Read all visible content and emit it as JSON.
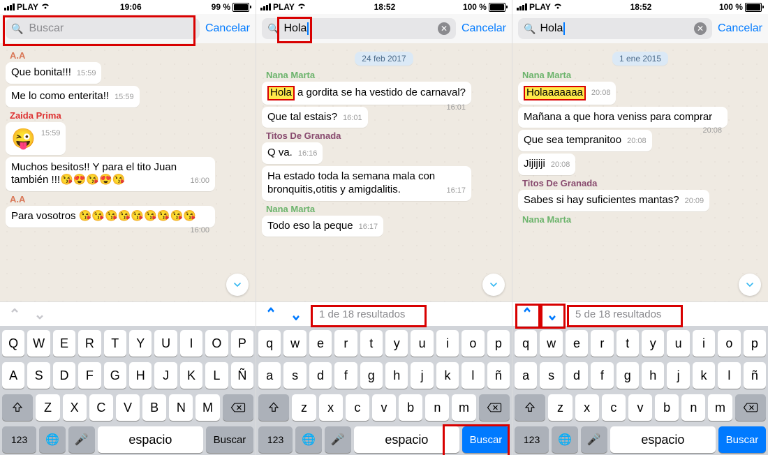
{
  "screens": [
    {
      "status": {
        "carrier": "PLAY",
        "time": "19:06",
        "battery": "99 %"
      },
      "search": {
        "placeholder": "Buscar",
        "value": "",
        "cancel": "Cancelar",
        "has_clear": false,
        "typed": false
      },
      "redboxes": {
        "search_field": true
      },
      "conversation": [
        {
          "type": "sender",
          "cls": "aa",
          "name": "A.A"
        },
        {
          "type": "msg",
          "text": "Que bonita!!!",
          "ts": "15:59"
        },
        {
          "type": "msg",
          "text": "Me lo como enterita!!",
          "ts": "15:59"
        },
        {
          "type": "sender",
          "cls": "zaida",
          "name": "Zaida Prima"
        },
        {
          "type": "msg",
          "html": "<span class='emoji'>😜</span>",
          "ts": "15:59"
        },
        {
          "type": "msg",
          "text": "Muchos besitos!! Y para el tito Juan también !!!😘😍😘😍😘",
          "ts": "16:00"
        },
        {
          "type": "sender",
          "cls": "aa",
          "name": "A.A"
        },
        {
          "type": "msg",
          "text": "Para vosotros 😘😘😘😘😘😘😘😘😘",
          "ts": "16:00"
        }
      ],
      "results": null,
      "keyboard": {
        "case": "upper",
        "search_label": "Buscar",
        "search_active": false,
        "space": "espacio",
        "num": "123"
      }
    },
    {
      "status": {
        "carrier": "PLAY",
        "time": "18:52",
        "battery": "100 %"
      },
      "search": {
        "placeholder": "Buscar",
        "value": "Hola",
        "cancel": "Cancelar",
        "has_clear": true,
        "typed": true
      },
      "redboxes": {
        "search_text": true,
        "results_count": true,
        "search_key": true
      },
      "date": "24 feb 2017",
      "conversation": [
        {
          "type": "sender",
          "cls": "nana",
          "name": "Nana Marta"
        },
        {
          "type": "msg",
          "html": "<span class='hl'>Hola</span> a gordita se ha vestido de carnaval?",
          "ts": "16:01"
        },
        {
          "type": "msg",
          "text": "Que tal estais?",
          "ts": "16:01"
        },
        {
          "type": "sender",
          "cls": "titos",
          "name": "Titos De Granada"
        },
        {
          "type": "msg",
          "text": "Q va.",
          "ts": "16:16"
        },
        {
          "type": "msg",
          "text": "Ha estado toda la semana mala con bronquitis,otitis y amigdalitis.",
          "ts": "16:17"
        },
        {
          "type": "sender",
          "cls": "nana",
          "name": "Nana Marta"
        },
        {
          "type": "msg",
          "text": "Todo eso la peque",
          "ts": "16:17"
        }
      ],
      "results": {
        "up_enabled": true,
        "down_enabled": true,
        "count": "1 de 18 resultados"
      },
      "keyboard": {
        "case": "lower",
        "search_label": "Buscar",
        "search_active": true,
        "space": "espacio",
        "num": "123"
      }
    },
    {
      "status": {
        "carrier": "PLAY",
        "time": "18:52",
        "battery": "100 %"
      },
      "search": {
        "placeholder": "Buscar",
        "value": "Hola",
        "cancel": "Cancelar",
        "has_clear": true,
        "typed": true
      },
      "redboxes": {
        "nav_arrows": true,
        "results_count": true
      },
      "date": "1 ene 2015",
      "conversation": [
        {
          "type": "sender",
          "cls": "nana",
          "name": "Nana Marta"
        },
        {
          "type": "msg",
          "html": "<span class='hl'>Holaaaaaaa</span>",
          "ts": "20:08"
        },
        {
          "type": "msg",
          "text": "Mañana a que hora veniss para comprar",
          "ts": "20:08"
        },
        {
          "type": "msg",
          "text": "Que sea tempranitoo",
          "ts": "20:08"
        },
        {
          "type": "msg",
          "text": "Jijijiji",
          "ts": "20:08"
        },
        {
          "type": "sender",
          "cls": "titos",
          "name": "Titos De Granada"
        },
        {
          "type": "msg",
          "text": "Sabes si hay suficientes mantas?",
          "ts": "20:09"
        },
        {
          "type": "sender",
          "cls": "nana",
          "name": "Nana Marta"
        }
      ],
      "results": {
        "up_enabled": true,
        "down_enabled": true,
        "count": "5 de 18 resultados"
      },
      "keyboard": {
        "case": "lower",
        "search_label": "Buscar",
        "search_active": true,
        "space": "espacio",
        "num": "123"
      }
    }
  ],
  "keys_upper": [
    [
      "Q",
      "W",
      "E",
      "R",
      "T",
      "Y",
      "U",
      "I",
      "O",
      "P"
    ],
    [
      "A",
      "S",
      "D",
      "F",
      "G",
      "H",
      "J",
      "K",
      "L",
      "Ñ"
    ],
    [
      "Z",
      "X",
      "C",
      "V",
      "B",
      "N",
      "M"
    ]
  ],
  "keys_lower": [
    [
      "q",
      "w",
      "e",
      "r",
      "t",
      "y",
      "u",
      "i",
      "o",
      "p"
    ],
    [
      "a",
      "s",
      "d",
      "f",
      "g",
      "h",
      "j",
      "k",
      "l",
      "ñ"
    ],
    [
      "z",
      "x",
      "c",
      "v",
      "b",
      "n",
      "m"
    ]
  ]
}
